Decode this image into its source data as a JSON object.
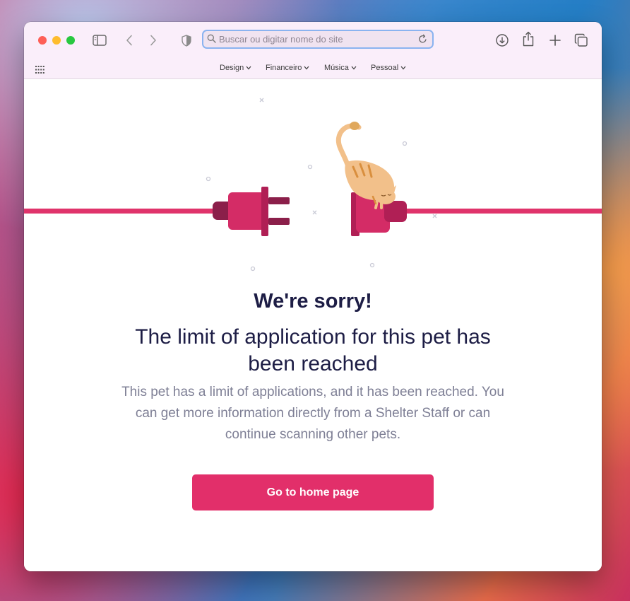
{
  "browser": {
    "address_bar": {
      "placeholder": "Buscar ou digitar nome do site",
      "value": ""
    },
    "favorites": [
      {
        "label": "Design"
      },
      {
        "label": "Financeiro"
      },
      {
        "label": "Música"
      },
      {
        "label": "Pessoal"
      }
    ],
    "traffic_light_colors": {
      "close": "#fe5f57",
      "minimize": "#febc2e",
      "zoom": "#28c840"
    }
  },
  "page": {
    "heading": "We're sorry!",
    "subheading": "The limit of application for this pet has been reached",
    "description": "This pet has a limit of applications, and it has been reached. You can get more information directly from a Shelter Staff or can continue scanning other pets.",
    "cta_label": "Go to home page",
    "colors": {
      "accent": "#e22f6a",
      "heading": "#1d1d45",
      "body_text": "#7e7f95",
      "plug_dark": "#8b1f4a"
    }
  }
}
